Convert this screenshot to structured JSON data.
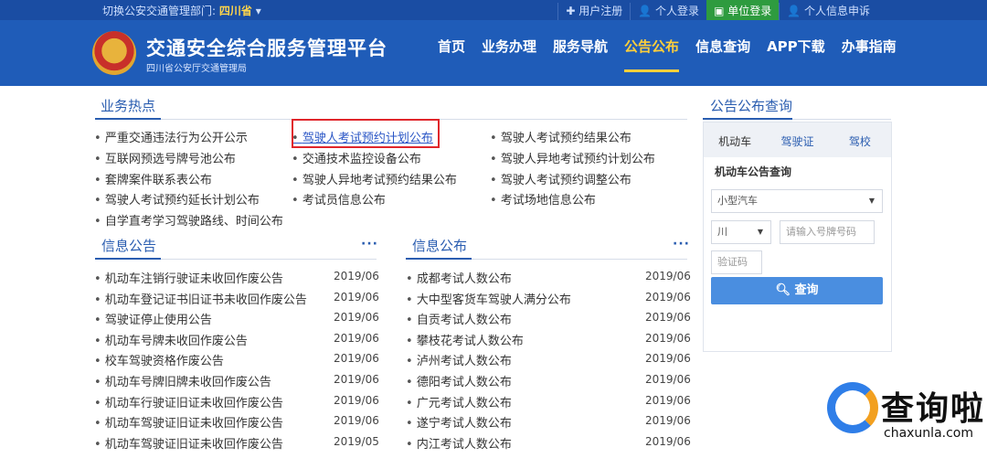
{
  "topbar": {
    "dept_label": "切换公安交通管理部门:",
    "province": "四川省",
    "links": [
      "✚ 用户注册",
      "👤 个人登录",
      "单位登录",
      "👤 个人信息申诉"
    ]
  },
  "header": {
    "title": "交通安全综合服务管理平台",
    "subtitle": "四川省公安厅交通管理局",
    "nav": [
      "首页",
      "业务办理",
      "服务导航",
      "公告公布",
      "信息查询",
      "APP下载",
      "办事指南"
    ],
    "active_nav": "公告公布"
  },
  "hot": {
    "title": "业务热点",
    "items": [
      "严重交通违法行为公开公示",
      "驾驶人考试预约计划公布",
      "驾驶人考试预约结果公布",
      "互联网预选号牌号池公布",
      "交通技术监控设备公布",
      "驾驶人异地考试预约计划公布",
      "套牌案件联系表公布",
      "驾驶人异地考试预约结果公布",
      "驾驶人考试预约调整公布",
      "驾驶人考试预约延长计划公布",
      "考试员信息公布",
      "考试场地信息公布",
      "自学直考学习驾驶路线、时间公布"
    ]
  },
  "info": {
    "title": "信息公告",
    "more": "···",
    "items": [
      {
        "text": "机动车注销行驶证未收回作废公告",
        "date": "2019/06"
      },
      {
        "text": "机动车登记证书旧证书未收回作废公告",
        "date": "2019/06"
      },
      {
        "text": "驾驶证停止使用公告",
        "date": "2019/06"
      },
      {
        "text": "机动车号牌未收回作废公告",
        "date": "2019/06"
      },
      {
        "text": "校车驾驶资格作废公告",
        "date": "2019/06"
      },
      {
        "text": "机动车号牌旧牌未收回作废公告",
        "date": "2019/06"
      },
      {
        "text": "机动车行驶证旧证未收回作废公告",
        "date": "2019/06"
      },
      {
        "text": "机动车驾驶证旧证未收回作废公告",
        "date": "2019/06"
      },
      {
        "text": "机动车驾驶证旧证未收回作废公告",
        "date": "2019/05"
      }
    ]
  },
  "pub": {
    "title": "信息公布",
    "more": "···",
    "items": [
      {
        "text": "成都考试人数公布",
        "date": "2019/06"
      },
      {
        "text": "大中型客货车驾驶人满分公布",
        "date": "2019/06"
      },
      {
        "text": "自贡考试人数公布",
        "date": "2019/06"
      },
      {
        "text": "攀枝花考试人数公布",
        "date": "2019/06"
      },
      {
        "text": "泸州考试人数公布",
        "date": "2019/06"
      },
      {
        "text": "德阳考试人数公布",
        "date": "2019/06"
      },
      {
        "text": "广元考试人数公布",
        "date": "2019/06"
      },
      {
        "text": "遂宁考试人数公布",
        "date": "2019/06"
      },
      {
        "text": "内江考试人数公布",
        "date": "2019/06"
      }
    ]
  },
  "query": {
    "title": "公告公布查询",
    "tabs": [
      "机动车",
      "驾驶证",
      "驾校"
    ],
    "subtitle": "机动车公告查询",
    "vehicle_type": "小型汽车",
    "province_abbr": "川",
    "plate_placeholder": "请输入号牌号码",
    "captcha_placeholder": "验证码",
    "button": "查询"
  },
  "watermark": {
    "text": "查询啦",
    "url": "chaxunla.com"
  },
  "colors": {
    "header_blue": "#1f5cb8",
    "accent_yellow": "#ffcf3a",
    "highlight_red": "#e0262b",
    "button_blue": "#4a8ee0"
  }
}
